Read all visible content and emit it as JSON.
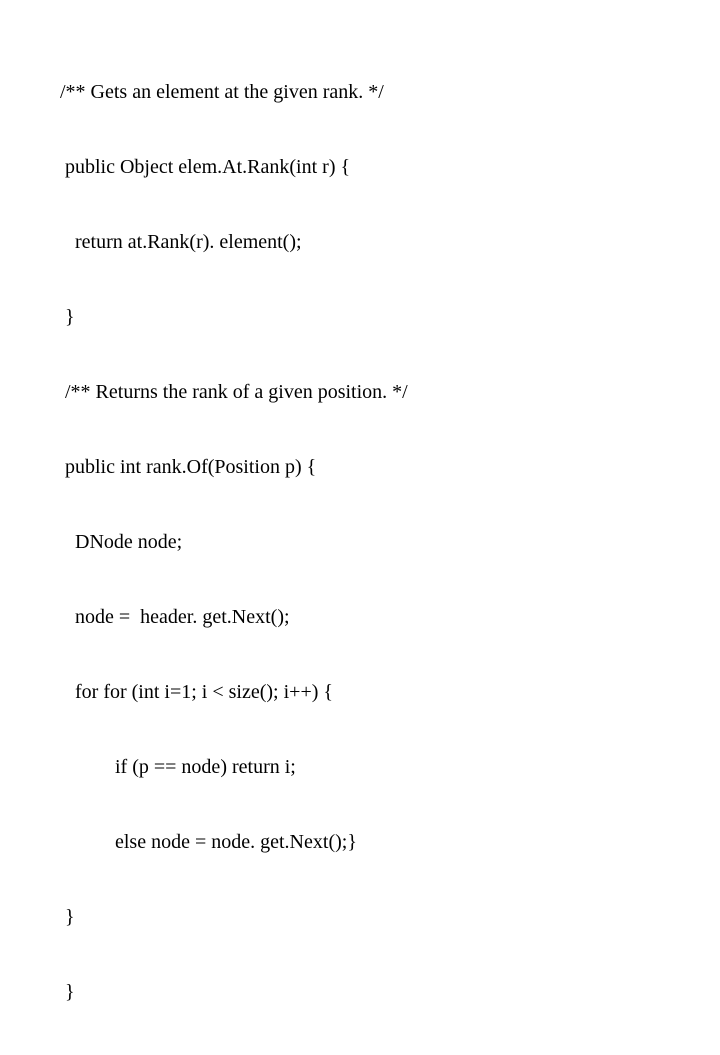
{
  "code": {
    "l1": "/** Gets an element at the given rank. */",
    "l2": " public Object elem.At.Rank(int r) {",
    "l3": "   return at.Rank(r). element();",
    "l4": " }",
    "l5": " /** Returns the rank of a given position. */",
    "l6": " public int rank.Of(Position p) {",
    "l7": "   DNode node;",
    "l8": "   node =  header. get.Next();",
    "l9": "   for for (int i=1; i < size(); i++) {",
    "l10": "           if (p == node) return i;",
    "l11": "           else node = node. get.Next();}",
    "l12": " }",
    "l13": " }"
  }
}
